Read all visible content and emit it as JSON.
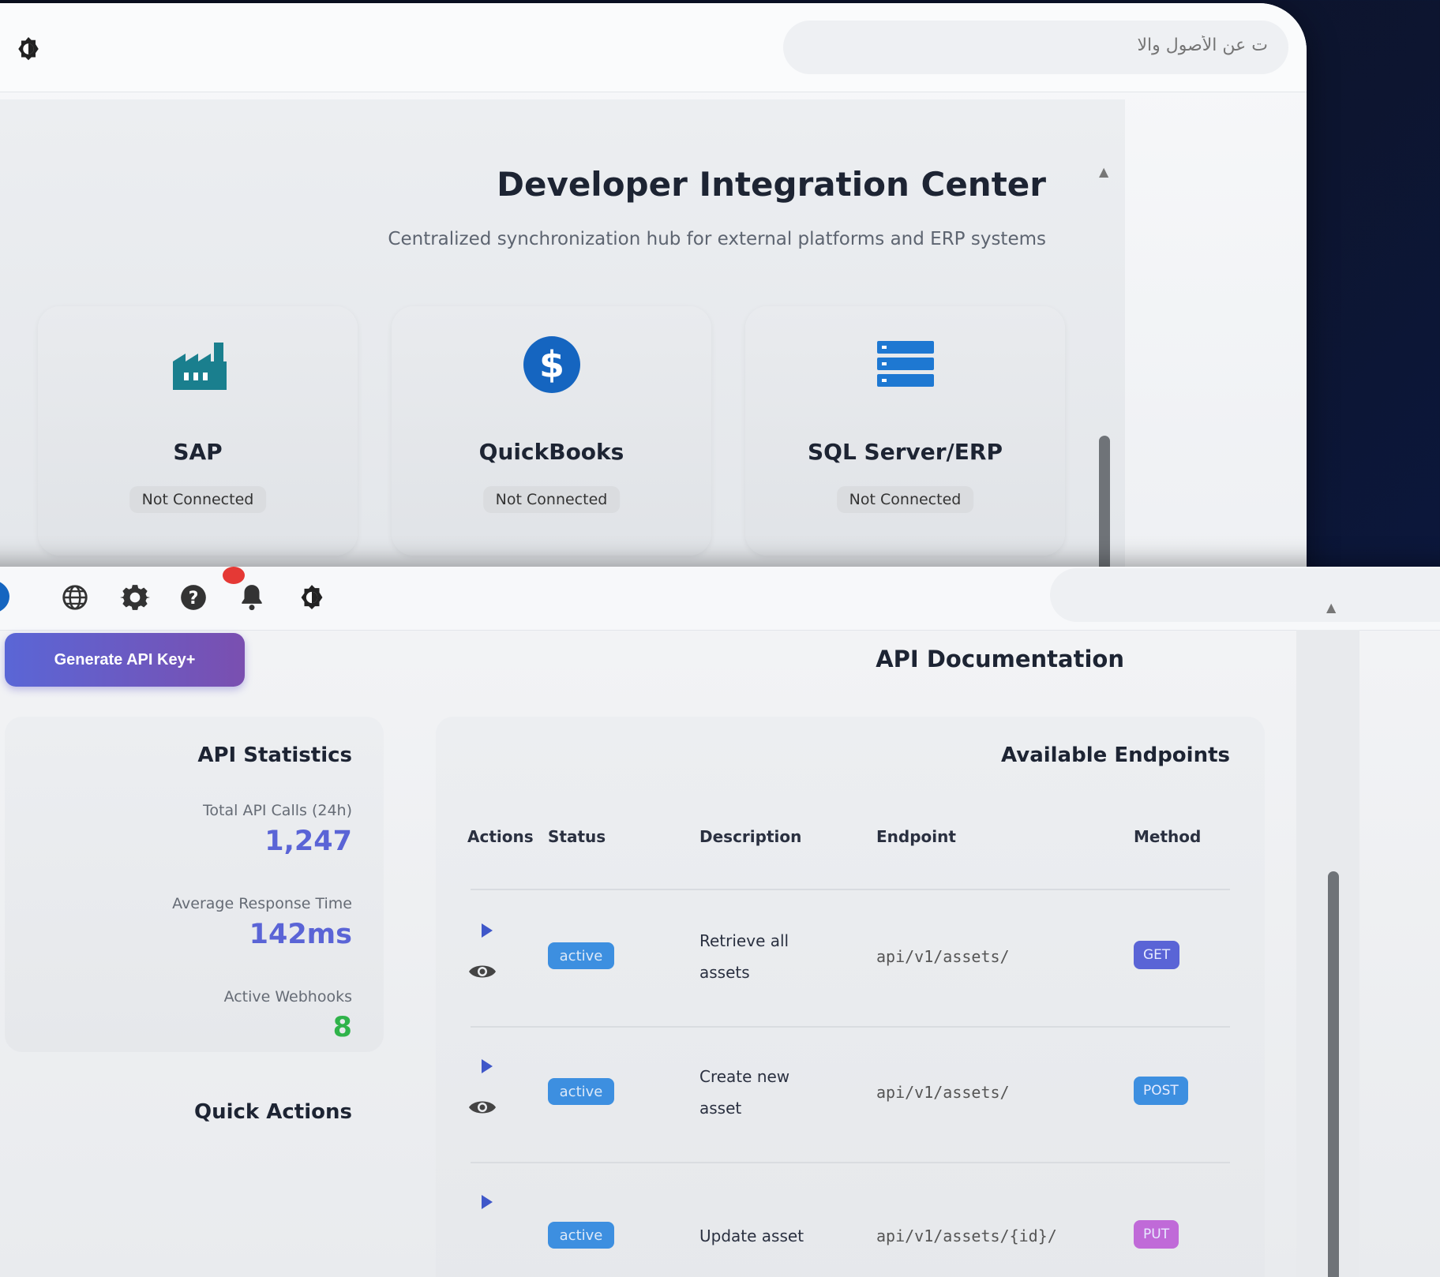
{
  "window1": {
    "search_placeholder": "ت عن الأصول والا",
    "title": "Developer Integration Center",
    "subtitle": "Centralized synchronization hub for external platforms and ERP systems",
    "integrations": [
      {
        "name": "SAP",
        "status": "Not Connected",
        "icon": "factory-icon",
        "color": "#1a7f8e"
      },
      {
        "name": "QuickBooks",
        "status": "Not Connected",
        "icon": "dollar-circle-icon",
        "color": "#1565c0"
      },
      {
        "name": "SQL Server/ERP",
        "status": "Not Connected",
        "icon": "server-icon",
        "color": "#1e78d2"
      }
    ]
  },
  "window2": {
    "generate_button": "Generate API Key+",
    "page_title": "API Documentation",
    "stats": {
      "title": "API Statistics",
      "items": [
        {
          "label": "Total API Calls (24h)",
          "value": "1,247"
        },
        {
          "label": "Average Response Time",
          "value": "142ms"
        },
        {
          "label": "Active Webhooks",
          "value": "8"
        }
      ]
    },
    "quick_actions_title": "Quick Actions",
    "endpoints": {
      "title": "Available Endpoints",
      "columns": [
        "Actions",
        "Status",
        "Description",
        "Endpoint",
        "Method"
      ],
      "rows": [
        {
          "status": "active",
          "description": "Retrieve all assets",
          "endpoint": "api/v1/assets/",
          "method": "GET",
          "method_color": "#5a64d6"
        },
        {
          "status": "active",
          "description": "Create new asset",
          "endpoint": "api/v1/assets/",
          "method": "POST",
          "method_color": "#3d8fe0"
        },
        {
          "status": "active",
          "description": "Update asset",
          "endpoint": "api/v1/assets/{id}/",
          "method": "PUT",
          "method_color": "#c06ad8"
        }
      ]
    }
  },
  "colors": {
    "accent": "#5a64d6",
    "success": "#2fb34a",
    "status_active": "#3d8fe0",
    "notification": "#e53935"
  }
}
